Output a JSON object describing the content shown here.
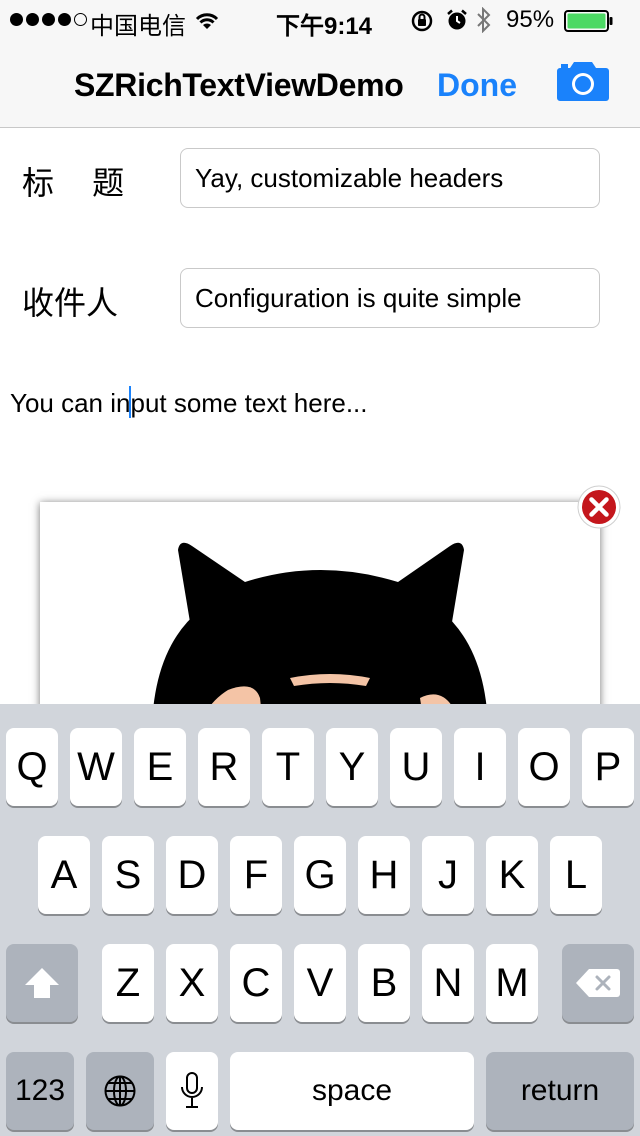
{
  "status_bar": {
    "carrier": "中国电信",
    "time": "下午9:14",
    "battery": "95%",
    "signal_dots_filled": 4,
    "signal_dots_total": 5,
    "battery_level": 0.95
  },
  "nav": {
    "title": "SZRichTextViewDemo",
    "done_label": "Done",
    "camera_icon": "camera-icon",
    "accent_color": "#1a82fb"
  },
  "form": {
    "title_label": "标 题",
    "title_value": "Yay, customizable headers",
    "recipient_label": "收件人",
    "recipient_value": "Configuration is quite simple"
  },
  "editor": {
    "text_before_caret": "You can in",
    "text_after_caret": "put some text here..."
  },
  "image": {
    "remove_icon": "close-circle-icon"
  },
  "keyboard": {
    "row1": [
      "Q",
      "W",
      "E",
      "R",
      "T",
      "Y",
      "U",
      "I",
      "O",
      "P"
    ],
    "row2": [
      "A",
      "S",
      "D",
      "F",
      "G",
      "H",
      "J",
      "K",
      "L"
    ],
    "row3": [
      "Z",
      "X",
      "C",
      "V",
      "B",
      "N",
      "M"
    ],
    "numbers_label": "123",
    "space_label": "space",
    "return_label": "return",
    "shift_icon": "shift-icon",
    "delete_icon": "delete-icon",
    "globe_icon": "globe-icon",
    "mic_icon": "microphone-icon"
  }
}
